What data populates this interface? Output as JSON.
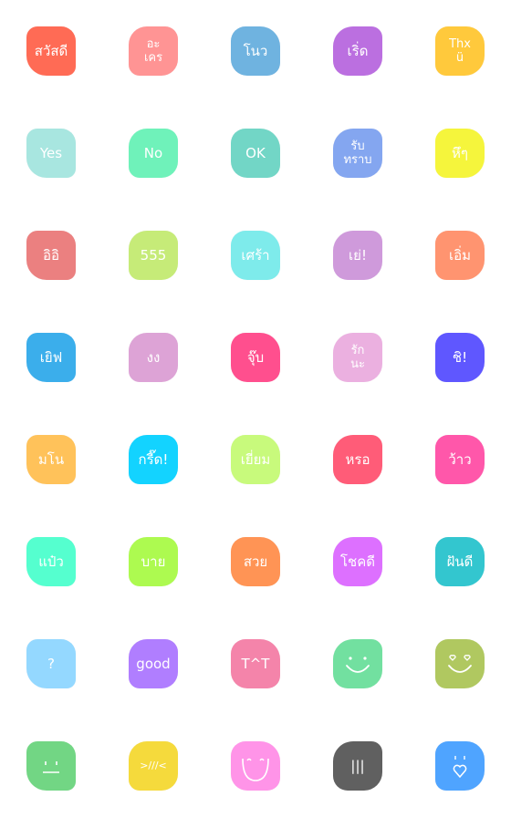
{
  "stickers": [
    {
      "label": "สวัสดี",
      "color": "#FF6B55"
    },
    {
      "label": "อะ",
      "label2": "เคร",
      "color": "#FF9494"
    },
    {
      "label": "โนว",
      "color": "#6FB3E0"
    },
    {
      "label": "เริ่ด",
      "color": "#BB6FE0"
    },
    {
      "label": "Thx",
      "label2": "ü",
      "color": "#FFC93C"
    },
    {
      "label": "Yes",
      "color": "#A8E6E0"
    },
    {
      "label": "No",
      "color": "#6FF2BA"
    },
    {
      "label": "OK",
      "color": "#72D6C6"
    },
    {
      "label": "รับ",
      "label2": "ทราบ",
      "color": "#84A6F0"
    },
    {
      "label": "หึๆ",
      "color": "#F5F53C"
    },
    {
      "label": "อิอิ",
      "color": "#EB8080"
    },
    {
      "label": "555",
      "color": "#C6EB78"
    },
    {
      "label": "เศร้า",
      "color": "#7EEBEB"
    },
    {
      "label": "เย่!",
      "color": "#CF9ADB"
    },
    {
      "label": "เอิ่ม",
      "color": "#FF9470"
    },
    {
      "label": "เยิฟ",
      "color": "#3BAEEB"
    },
    {
      "label": "งง",
      "color": "#DDA3D6"
    },
    {
      "label": "จุ๊บ",
      "color": "#FF4F8E"
    },
    {
      "label": "รัก",
      "label2": "นะ",
      "color": "#EBB0E0"
    },
    {
      "label": "ชิ!",
      "color": "#5F57FF"
    },
    {
      "label": "มโน",
      "color": "#FFC25A"
    },
    {
      "label": "กรี๊ด!",
      "color": "#13D3FF"
    },
    {
      "label": "เยี่ยม",
      "color": "#C8FA7C"
    },
    {
      "label": "หรอ",
      "color": "#FF5C78"
    },
    {
      "label": "ว้าว",
      "color": "#FF57AA"
    },
    {
      "label": "แป๋ว",
      "color": "#55FFCF"
    },
    {
      "label": "บาย",
      "color": "#ADFA50"
    },
    {
      "label": "สวย",
      "color": "#FF9455"
    },
    {
      "label": "โชคดี",
      "color": "#DD70FF"
    },
    {
      "label": "ฝันดี",
      "color": "#33C6CF"
    },
    {
      "label": "?",
      "color": "#94D8FF"
    },
    {
      "label": "good",
      "color": "#B07EFF"
    },
    {
      "label": "T^T",
      "color": "#F484AA"
    },
    {
      "face": "smile",
      "color": "#72E0A0"
    },
    {
      "face": "heart-eyes",
      "color": "#B0C860"
    },
    {
      "face": "neutral",
      "color": "#72D684"
    },
    {
      "label": ">///<",
      "color": "#F5DA3C"
    },
    {
      "face": "happy",
      "color": "#FF94E8"
    },
    {
      "label": "|||",
      "color": "#606060"
    },
    {
      "face": "heart",
      "color": "#4FA4FF"
    }
  ]
}
